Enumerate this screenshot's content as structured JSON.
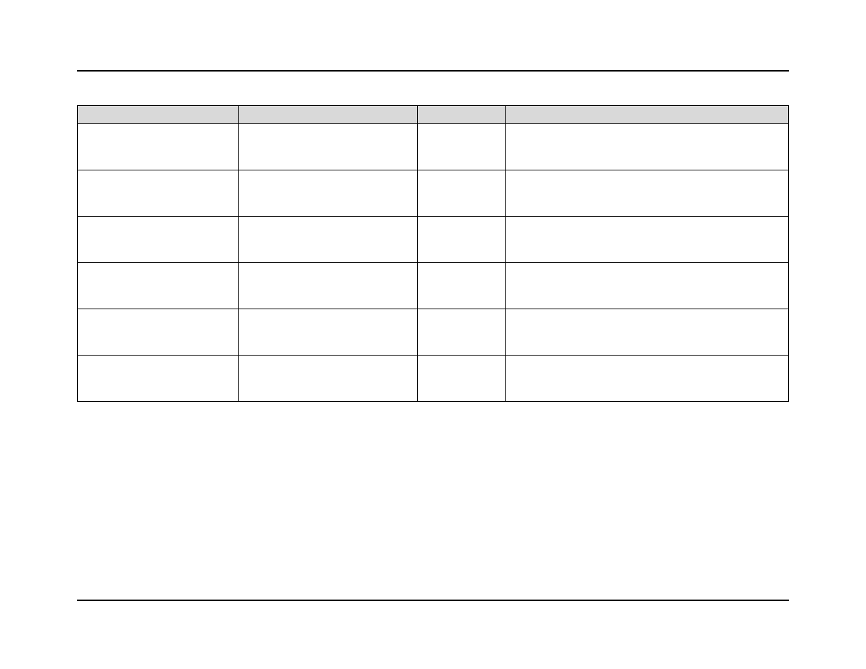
{
  "table": {
    "headers": [
      "",
      "",
      "",
      ""
    ],
    "rows": [
      [
        "",
        "",
        "",
        ""
      ],
      [
        "",
        "",
        "",
        ""
      ],
      [
        "",
        "",
        "",
        ""
      ],
      [
        "",
        "",
        "",
        ""
      ],
      [
        "",
        "",
        "",
        ""
      ],
      [
        "",
        "",
        "",
        ""
      ]
    ]
  }
}
